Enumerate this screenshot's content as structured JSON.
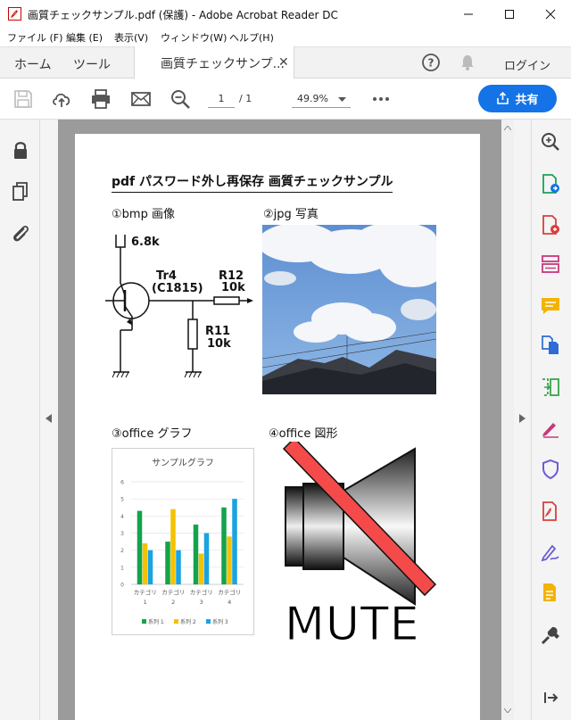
{
  "window": {
    "title": "画質チェックサンプル.pdf (保護) - Adobe Acrobat Reader DC"
  },
  "menu": {
    "file": "ファイル (F)",
    "edit": "編集 (E)",
    "view": "表示(V)",
    "window": "ウィンドウ(W)",
    "help": "ヘルプ(H)"
  },
  "tabs": {
    "home": "ホーム",
    "tools": "ツール",
    "document": "画質チェックサンプ...",
    "login": "ログイン"
  },
  "toolbar": {
    "page_current": "1",
    "page_total": "/ 1",
    "zoom": "49.9%",
    "share": "共有"
  },
  "document": {
    "heading": "pdf パスワード外し再保存 画質チェックサンプル",
    "section1": "①bmp 画像",
    "section2": "②jpg 写真",
    "section3": "③office グラフ",
    "section4": "④office 図形",
    "circuit": {
      "v": "6.8k",
      "tr": "Tr4",
      "tr_model": "(C1815)",
      "r12": "R12",
      "r12_val": "10k",
      "r11": "R11",
      "r11_val": "10k"
    },
    "mute_text": "MUTE"
  },
  "chart_data": {
    "type": "bar",
    "title": "サンプルグラフ",
    "categories": [
      "カテゴリ 1",
      "カテゴリ 2",
      "カテゴリ 3",
      "カテゴリ 4"
    ],
    "category_lines": [
      [
        "カテゴリ",
        "1"
      ],
      [
        "カテゴリ",
        "2"
      ],
      [
        "カテゴリ",
        "3"
      ],
      [
        "カテゴリ",
        "4"
      ]
    ],
    "series": [
      {
        "name": "系列 1",
        "values": [
          4.3,
          2.5,
          3.5,
          4.5
        ],
        "color": "#13a34c"
      },
      {
        "name": "系列 2",
        "values": [
          2.4,
          4.4,
          1.8,
          2.8
        ],
        "color": "#f5c200"
      },
      {
        "name": "系列 3",
        "values": [
          2.0,
          2.0,
          3.0,
          5.0
        ],
        "color": "#1aa3e0"
      }
    ],
    "ylim": [
      0,
      6
    ],
    "yticks": [
      "0",
      "1",
      "2",
      "3",
      "4",
      "5",
      "6"
    ],
    "grid": true,
    "legend": "bottom"
  },
  "colors": {
    "accent": "#1473e6",
    "mute_slash": "#f44a4a"
  }
}
